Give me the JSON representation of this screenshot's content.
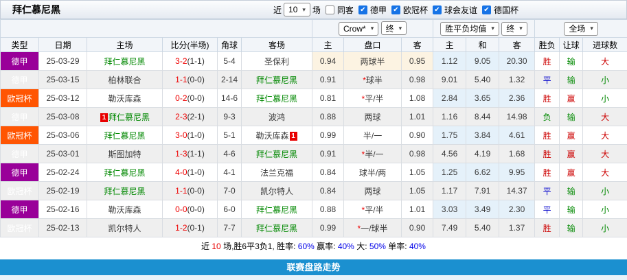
{
  "icons": {
    "dropdown_caret": "▾",
    "check": "✔"
  },
  "title": "拜仁慕尼黑",
  "toolbar": {
    "recent_prefix": "近",
    "recent_select": "10",
    "recent_suffix": "场",
    "same_away": {
      "label": "同客",
      "checked": false
    },
    "leagues": [
      {
        "label": "德甲",
        "checked": true
      },
      {
        "label": "欧冠杯",
        "checked": true
      },
      {
        "label": "球会友谊",
        "checked": true
      },
      {
        "label": "德国杯",
        "checked": true
      }
    ]
  },
  "selectors": {
    "bookmaker": "Crow*",
    "bookmaker_time": "终",
    "avg": "胜平负均值",
    "avg_time": "终",
    "scope": "全场"
  },
  "columns": [
    "类型",
    "日期",
    "主场",
    "比分(半场)",
    "角球",
    "客场",
    "主",
    "盘口",
    "客",
    "主",
    "和",
    "客",
    "胜负",
    "让球",
    "进球数"
  ],
  "rows": [
    {
      "cls": "hl",
      "type": "德甲",
      "tc": "t-de",
      "date": "25-03-29",
      "home": "拜仁慕尼黑",
      "hc": "c-team",
      "ft": "3-2",
      "ht": "(1-1)",
      "corner": "5-4",
      "away": "圣保利",
      "o1": "0.94",
      "pan": "两球半",
      "o2": "0.95",
      "m1": "1.12",
      "m2": "9.05",
      "m3": "20.30",
      "r1t": "胜",
      "r1c": "c-red",
      "r2t": "输",
      "r2c": "c-green",
      "r3t": "大",
      "r3c": "c-red"
    },
    {
      "type": "德甲",
      "tc": "t-de",
      "date": "25-03-15",
      "home": "柏林联合",
      "ft": "1-1",
      "ht": "(0-0)",
      "corner": "2-14",
      "away": "拜仁慕尼黑",
      "ac": "c-team",
      "o1": "0.91",
      "star": "*",
      "pan": "球半",
      "o2": "0.98",
      "m1": "9.01",
      "m2": "5.40",
      "m3": "1.32",
      "r1t": "平",
      "r1c": "c-blue",
      "r2t": "输",
      "r2c": "c-green",
      "r3t": "小",
      "r3c": "c-green"
    },
    {
      "type": "欧冠杯",
      "tc": "t-cl",
      "date": "25-03-12",
      "home": "勒沃库森",
      "ft": "0-2",
      "ht": "(0-0)",
      "corner": "14-6",
      "away": "拜仁慕尼黑",
      "ac": "c-team",
      "o1": "0.81",
      "star": "*",
      "pan": "平/半",
      "o2": "1.08",
      "m1": "2.84",
      "m2": "3.65",
      "m3": "2.36",
      "r1t": "胜",
      "r1c": "c-red",
      "r2t": "赢",
      "r2c": "c-red",
      "r3t": "小",
      "r3c": "c-green"
    },
    {
      "type": "德甲",
      "tc": "t-de",
      "date": "25-03-08",
      "home": "拜仁慕尼黑",
      "hc": "c-team",
      "hrc": "1",
      "ft": "2-3",
      "ht": "(2-1)",
      "corner": "9-3",
      "away": "波鸿",
      "o1": "0.88",
      "pan": "两球",
      "o2": "1.01",
      "m1": "1.16",
      "m2": "8.44",
      "m3": "14.98",
      "r1t": "负",
      "r1c": "c-green",
      "r2t": "输",
      "r2c": "c-green",
      "r3t": "大",
      "r3c": "c-red"
    },
    {
      "type": "欧冠杯",
      "tc": "t-cl",
      "date": "25-03-06",
      "home": "拜仁慕尼黑",
      "hc": "c-team",
      "ft": "3-0",
      "ht": "(1-0)",
      "corner": "5-1",
      "away": "勒沃库森",
      "arc": "1",
      "o1": "0.99",
      "pan": "半/一",
      "o2": "0.90",
      "m1": "1.75",
      "m2": "3.84",
      "m3": "4.61",
      "r1t": "胜",
      "r1c": "c-red",
      "r2t": "赢",
      "r2c": "c-red",
      "r3t": "大",
      "r3c": "c-red"
    },
    {
      "type": "德甲",
      "tc": "t-de",
      "date": "25-03-01",
      "home": "斯图加特",
      "ft": "1-3",
      "ht": "(1-1)",
      "corner": "4-6",
      "away": "拜仁慕尼黑",
      "ac": "c-team",
      "o1": "0.91",
      "star": "*",
      "pan": "半/一",
      "o2": "0.98",
      "m1": "4.56",
      "m2": "4.19",
      "m3": "1.68",
      "r1t": "胜",
      "r1c": "c-red",
      "r2t": "赢",
      "r2c": "c-red",
      "r3t": "大",
      "r3c": "c-red"
    },
    {
      "type": "德甲",
      "tc": "t-de",
      "date": "25-02-24",
      "home": "拜仁慕尼黑",
      "hc": "c-team",
      "ft": "4-0",
      "ht": "(1-0)",
      "corner": "4-1",
      "away": "法兰克福",
      "o1": "0.84",
      "pan": "球半/两",
      "o2": "1.05",
      "m1": "1.25",
      "m2": "6.62",
      "m3": "9.95",
      "r1t": "胜",
      "r1c": "c-red",
      "r2t": "赢",
      "r2c": "c-red",
      "r3t": "大",
      "r3c": "c-red"
    },
    {
      "type": "欧冠杯",
      "tc": "t-cl",
      "date": "25-02-19",
      "home": "拜仁慕尼黑",
      "hc": "c-team",
      "ft": "1-1",
      "ht": "(0-0)",
      "corner": "7-0",
      "away": "凯尔特人",
      "o1": "0.84",
      "pan": "两球",
      "o2": "1.05",
      "m1": "1.17",
      "m2": "7.91",
      "m3": "14.37",
      "r1t": "平",
      "r1c": "c-blue",
      "r2t": "输",
      "r2c": "c-green",
      "r3t": "小",
      "r3c": "c-green"
    },
    {
      "type": "德甲",
      "tc": "t-de",
      "date": "25-02-16",
      "home": "勒沃库森",
      "ft": "0-0",
      "ht": "(0-0)",
      "corner": "6-0",
      "away": "拜仁慕尼黑",
      "ac": "c-team",
      "o1": "0.88",
      "star": "*",
      "pan": "平/半",
      "o2": "1.01",
      "m1": "3.03",
      "m2": "3.49",
      "m3": "2.30",
      "r1t": "平",
      "r1c": "c-blue",
      "r2t": "输",
      "r2c": "c-green",
      "r3t": "小",
      "r3c": "c-green"
    },
    {
      "type": "欧冠杯",
      "tc": "t-cl",
      "date": "25-02-13",
      "home": "凯尔特人",
      "ft": "1-2",
      "ht": "(0-1)",
      "corner": "7-7",
      "away": "拜仁慕尼黑",
      "ac": "c-team",
      "o1": "0.99",
      "star": "*",
      "pan": "一/球半",
      "o2": "0.90",
      "m1": "7.49",
      "m2": "5.40",
      "m3": "1.37",
      "r1t": "胜",
      "r1c": "c-red",
      "r2t": "输",
      "r2c": "c-green",
      "r3t": "小",
      "r3c": "c-green"
    }
  ],
  "summary": {
    "segments": [
      {
        "t": "近"
      },
      {
        "t": "10",
        "c": "c-red"
      },
      {
        "t": "场,胜6平3负1, 胜率:"
      },
      {
        "t": "60%",
        "c": "c-pct"
      },
      {
        "t": " 赢率:"
      },
      {
        "t": "40%",
        "c": "c-pct"
      },
      {
        "t": " 大:"
      },
      {
        "t": "50%",
        "c": "c-pct"
      },
      {
        "t": " 单率:"
      },
      {
        "t": "40%",
        "c": "c-pct"
      }
    ]
  },
  "footer": {
    "label": "联赛盘路走势"
  },
  "colors": {
    "league_de": "#990099",
    "league_cl": "#ff5502",
    "team_green": "#008800",
    "score_red": "#ee0000",
    "result_red": "#cc0000",
    "result_blue": "#0000cc",
    "result_green": "#008800",
    "avg_col_bg": "#e5f1fa",
    "highlight_bg": "#fcf3e2",
    "footer_blue": "#1b90d0"
  }
}
